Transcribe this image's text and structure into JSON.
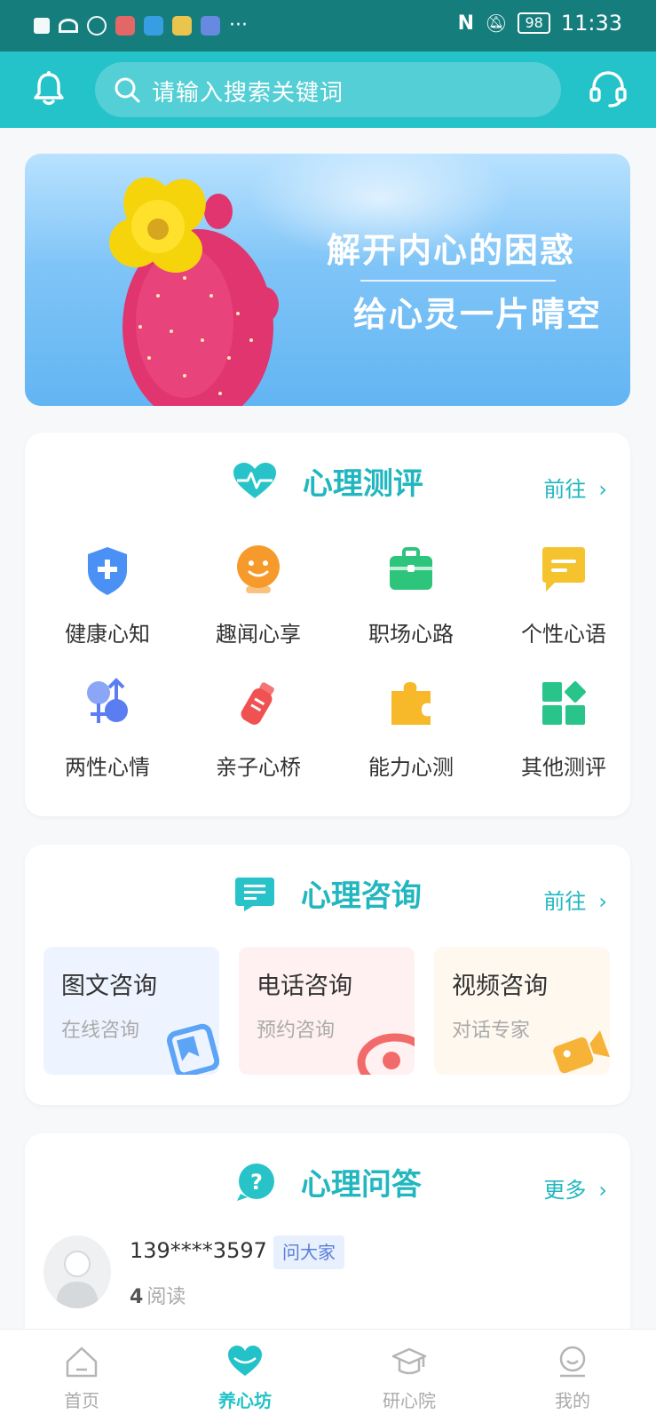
{
  "status_bar": {
    "time": "11:33",
    "battery": "98",
    "more": "···"
  },
  "header": {
    "search_placeholder": "请输入搜索关键词",
    "bell_icon": "bell-icon",
    "support_icon": "headset-icon"
  },
  "banner": {
    "line1": "解开内心的困惑",
    "line2": "给心灵一片晴空"
  },
  "assessment": {
    "title": "心理测评",
    "goto": "前往",
    "items": [
      {
        "label": "健康心知",
        "icon": "shield-plus-icon",
        "color": "#4a90f5"
      },
      {
        "label": "趣闻心享",
        "icon": "smile-icon",
        "color": "#f79a2c"
      },
      {
        "label": "职场心路",
        "icon": "briefcase-icon",
        "color": "#2cc57b"
      },
      {
        "label": "个性心语",
        "icon": "chat-icon",
        "color": "#f5c32d"
      },
      {
        "label": "两性心情",
        "icon": "gender-icon",
        "color": "#5b7df2"
      },
      {
        "label": "亲子心桥",
        "icon": "baby-bottle-icon",
        "color": "#f05252"
      },
      {
        "label": "能力心测",
        "icon": "puzzle-icon",
        "color": "#f7b92a"
      },
      {
        "label": "其他测评",
        "icon": "grid-apps-icon",
        "color": "#29c48a"
      }
    ]
  },
  "consultation": {
    "title": "心理咨询",
    "goto": "前往",
    "items": [
      {
        "title": "图文咨询",
        "sub": "在线咨询",
        "bg": "#eef4ff",
        "icon": "image-text-icon",
        "color": "#5ca4f5"
      },
      {
        "title": "电话咨询",
        "sub": "预约咨询",
        "bg": "#fff1f1",
        "icon": "phone-icon",
        "color": "#f26b6b"
      },
      {
        "title": "视频咨询",
        "sub": "对话专家",
        "bg": "#fff8ef",
        "icon": "video-icon",
        "color": "#f7b338"
      }
    ]
  },
  "qa": {
    "title": "心理问答",
    "more": "更多",
    "post": {
      "user": "139****3597",
      "badge": "问大家",
      "read_count": "4",
      "read_label": "阅读"
    }
  },
  "bottom_nav": [
    {
      "label": "首页",
      "icon": "home-icon",
      "active": false
    },
    {
      "label": "养心坊",
      "icon": "heart-icon",
      "active": true
    },
    {
      "label": "研心院",
      "icon": "graduation-cap-icon",
      "active": false
    },
    {
      "label": "我的",
      "icon": "profile-icon",
      "active": false
    }
  ],
  "colors": {
    "teal": "#24c2c9",
    "statusbar": "#167d7d",
    "accent_text": "#22b7bf"
  }
}
